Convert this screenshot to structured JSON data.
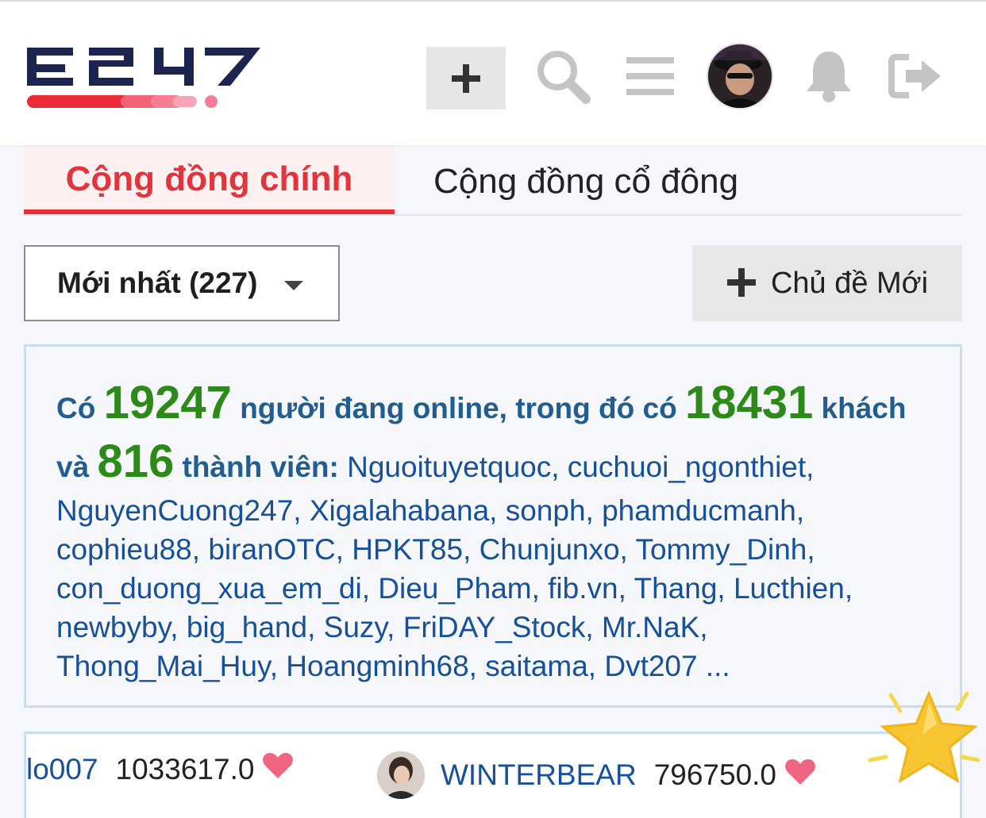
{
  "header": {
    "logo_text": "F247",
    "add_label": "+"
  },
  "tabs": [
    {
      "label": "Cộng đồng chính"
    },
    {
      "label": "Cộng đồng cổ đông"
    }
  ],
  "filter": {
    "sort_label": "Mới nhất (227)",
    "new_topic_label": "Chủ đề Mới"
  },
  "online": {
    "prefix": "Có",
    "total": "19247",
    "mid": "người đang online, trong đó có",
    "guests": "18431",
    "guests_label": "khách và",
    "members": "816",
    "members_label": "thành viên:",
    "member_list": "Nguoituyetquoc, cuchuoi_ngonthiet, NguyenCuong247, Xigalahabana, sonph, phamducmanh, cophieu88, biranOTC, HPKT85, Chunjunxo, Tommy_Dinh, con_duong_xua_em_di, Dieu_Pham, fib.vn, Thang, Lucthien, newbyby, big_hand, Suzy, FriDAY_Stock, Mr.NaK, Thong_Mai_Huy, Hoangminh68, saitama, Dvt207 ..."
  },
  "ranking": [
    {
      "name": "lo007",
      "score": "1033617.0"
    },
    {
      "name": "WINTERBEAR",
      "score": "796750.0"
    }
  ],
  "colors": {
    "accent_red": "#e3343c",
    "online_green": "#2b8a18",
    "member_blue": "#164f9a",
    "logo_navy": "#1c2550"
  }
}
